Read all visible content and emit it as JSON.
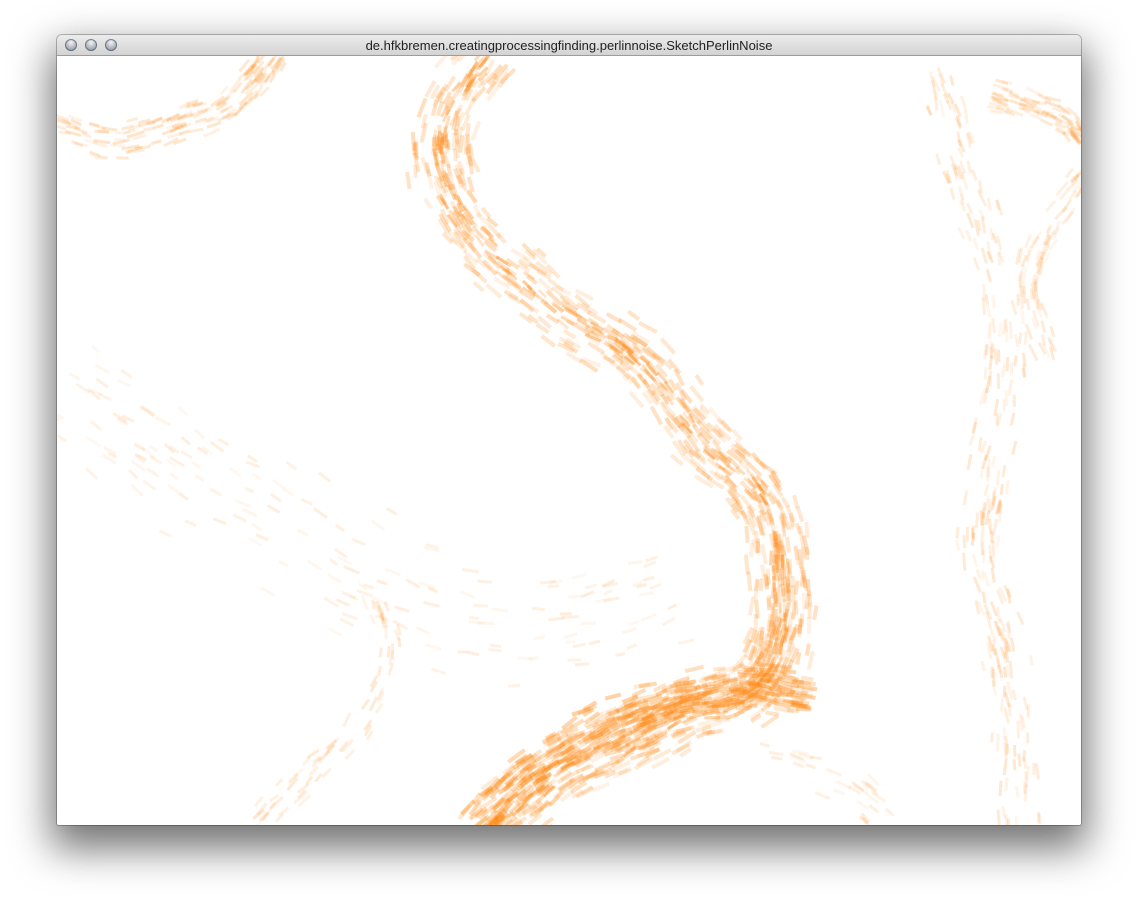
{
  "window": {
    "title": "de.hfkbremen.creatingprocessingfinding.perlinnoise.SketchPerlinNoise",
    "buttons": [
      "close",
      "minimize",
      "zoom"
    ]
  },
  "canvas": {
    "background": "#ffffff",
    "stroke_color": "#ff8c1a",
    "content": "perlin-noise-flow-strokes"
  }
}
